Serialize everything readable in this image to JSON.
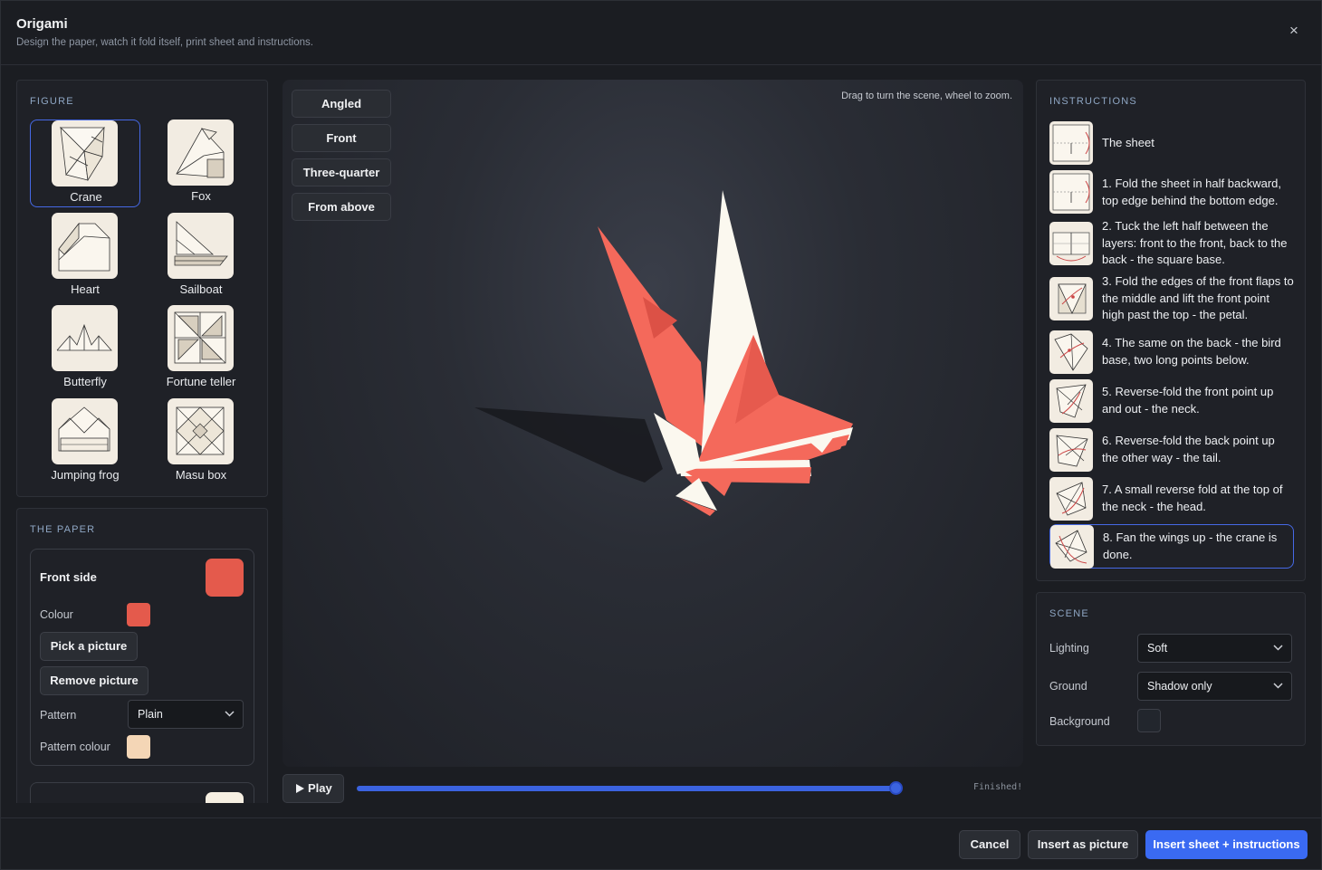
{
  "app": {
    "title": "Origami",
    "subtitle": "Design the paper, watch it fold itself, print sheet and instructions.",
    "close_glyph": "×"
  },
  "figure": {
    "section": "FIGURE",
    "items": [
      {
        "label": "Crane",
        "selected": true
      },
      {
        "label": "Fox",
        "selected": false
      },
      {
        "label": "Heart",
        "selected": false
      },
      {
        "label": "Sailboat",
        "selected": false
      },
      {
        "label": "Butterfly",
        "selected": false
      },
      {
        "label": "Fortune teller",
        "selected": false
      },
      {
        "label": "Jumping frog",
        "selected": false
      },
      {
        "label": "Masu box",
        "selected": false
      }
    ]
  },
  "paper": {
    "section": "THE PAPER",
    "front_side_label": "Front side",
    "front_color": "#e45a4c",
    "colour_label": "Colour",
    "pick_picture": "Pick a picture",
    "remove_picture": "Remove picture",
    "pattern_label": "Pattern",
    "pattern_value": "Plain",
    "pattern_colour_label": "Pattern colour",
    "pattern_color": "#f4d6b6",
    "back_color": "#f6efe2"
  },
  "viewport": {
    "views": [
      "Angled",
      "Front",
      "Three-quarter",
      "From above"
    ],
    "hint": "Drag to turn the scene, wheel to zoom.",
    "play_label": "Play",
    "play_icon": "play-icon",
    "progress": 1.0,
    "status": "Finished!"
  },
  "instructions": {
    "section": "INSTRUCTIONS",
    "steps": [
      {
        "text": "The sheet"
      },
      {
        "text": "1. Fold the sheet in half backward, top edge behind the bottom edge."
      },
      {
        "text": "2. Tuck the left half between the layers: front to the front, back to the back - the square base."
      },
      {
        "text": "3. Fold the edges of the front flaps to the middle and lift the front point high past the top - the petal."
      },
      {
        "text": "4. The same on the back - the bird base, two long points below."
      },
      {
        "text": "5. Reverse-fold the front point up and out - the neck."
      },
      {
        "text": "6. Reverse-fold the back point up the other way - the tail."
      },
      {
        "text": "7. A small reverse fold at the top of the neck - the head."
      },
      {
        "text": "8. Fan the wings up - the crane is done."
      }
    ],
    "selected_step": 8
  },
  "scene": {
    "section": "SCENE",
    "lighting_label": "Lighting",
    "lighting_value": "Soft",
    "ground_label": "Ground",
    "ground_value": "Shadow only",
    "background_label": "Background",
    "background_color": "#22262d"
  },
  "footer": {
    "cancel": "Cancel",
    "insert_picture": "Insert as picture",
    "insert_sheet": "Insert sheet + instructions"
  },
  "colors": {
    "accent": "#3a6af2",
    "paper_front": "#f46c5e",
    "paper_back": "#faf6ec"
  }
}
